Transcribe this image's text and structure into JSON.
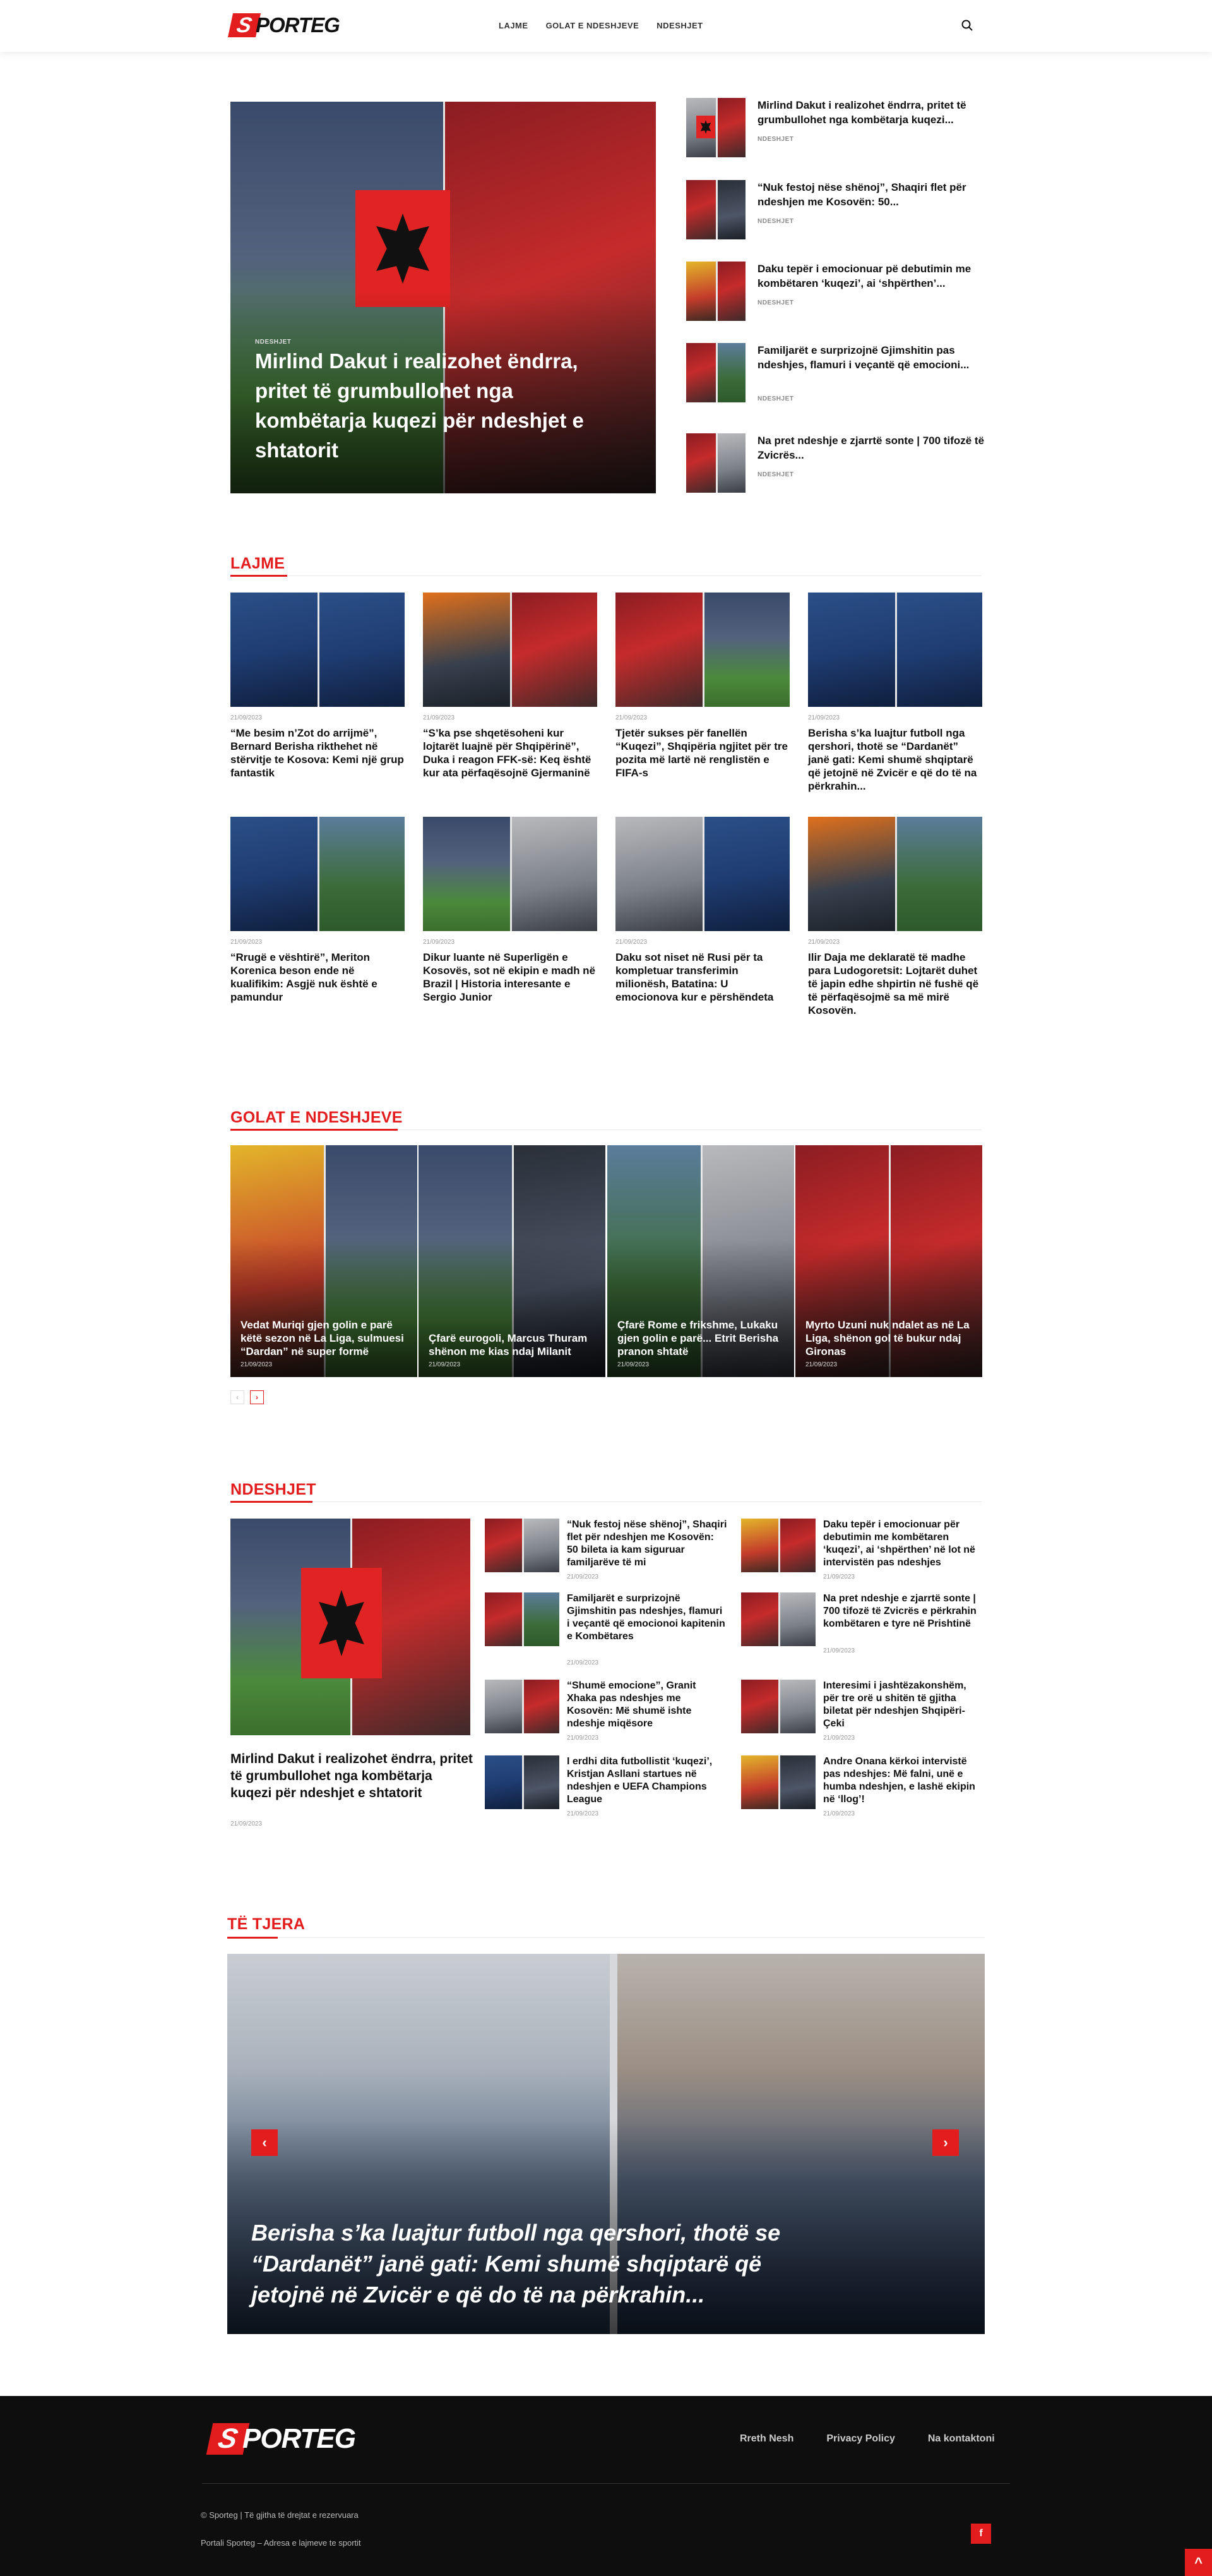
{
  "header": {
    "logo_s": "S",
    "logo_rest": "PORTEG",
    "nav": [
      "LAJME",
      "GOLAT E NDESHJEVE",
      "NDESHJET"
    ],
    "search_icon": "search-icon"
  },
  "hero": {
    "category": "NDESHJET",
    "title": "Mirlind Dakut i realizohet ëndrra, pritet të grumbullohet nga kombëtarja kuqezi për ndeshjet e shtatorit"
  },
  "side_list": [
    {
      "title": "Mirlind Dakut i realizohet ëndrra, pritet të grumbullohet nga kombëtarja kuqezi...",
      "category": "NDESHJET"
    },
    {
      "title": "“Nuk festoj nëse shënoj”, Shaqiri flet për ndeshjen me Kosovën: 50...",
      "category": "NDESHJET"
    },
    {
      "title": "Daku tepër i emocionuar pë debutimin me kombëtaren ‘kuqezi’, ai ‘shpërthen’...",
      "category": "NDESHJET"
    },
    {
      "title": "Familjarët e surprizojnë Gjimshitin pas ndeshjes, flamuri i veçantë që emocioni...",
      "category": "NDESHJET"
    },
    {
      "title": "Na pret ndeshje e zjarrtë sonte | 700 tifozë të Zvicrës...",
      "category": "NDESHJET"
    }
  ],
  "lajme": {
    "title": "LAJME",
    "cards": [
      {
        "date": "21/09/2023",
        "title": "“Me besim n’Zot do arrijmë”, Bernard Berisha rikthehet në stërvitje te Kosova: Kemi një grup fantastik"
      },
      {
        "date": "21/09/2023",
        "title": "“S’ka pse shqetësoheni kur lojtarët luajnë për Shqipërinë”, Duka i reagon FFK-së: Keq është kur ata përfaqësojnë Gjermaninë"
      },
      {
        "date": "21/09/2023",
        "title": "Tjetër sukses për fanellën “Kuqezi”, Shqipëria ngjitet për tre pozita më lartë në renglistën e FIFA-s"
      },
      {
        "date": "21/09/2023",
        "title": "Berisha s’ka luajtur futboll nga qershori, thotë se “Dardanët” janë gati: Kemi shumë shqiptarë që jetojnë në Zvicër e që do të na përkrahin..."
      },
      {
        "date": "21/09/2023",
        "title": "“Rrugë e vështirë”, Meriton Korenica beson ende në kualifikim: Asgjë nuk është e pamundur"
      },
      {
        "date": "21/09/2023",
        "title": "Dikur luante në Superligën e Kosovës, sot në ekipin e madh në Brazil | Historia interesante e Sergio Junior"
      },
      {
        "date": "21/09/2023",
        "title": "Daku sot niset në Rusi për ta kompletuar transferimin milionësh, Batatina: U emocionova kur e përshëndeta"
      },
      {
        "date": "21/09/2023",
        "title": "Ilir Daja me deklaratë të madhe para Ludogoretsit: Lojtarët duhet të japin edhe shpirtin në fushë që të përfaqësojmë sa më mirë Kosovën."
      }
    ]
  },
  "golat": {
    "title": "GOLAT E NDESHJEVE",
    "cards": [
      {
        "title": "Vedat Muriqi gjen golin e parë këtë sezon në La Liga, sulmuesi “Dardan” në super formë",
        "date": "21/09/2023"
      },
      {
        "title": "Çfarë eurogoli, Marcus Thuram shënon me kias ndaj Milanit",
        "date": "21/09/2023"
      },
      {
        "title": "Çfarë Rome e frikshme, Lukaku gjen golin e parë... Etrit Berisha pranon shtatë",
        "date": "21/09/2023"
      },
      {
        "title": "Myrto Uzuni nuk ndalet as në La Liga, shënon gol të bukur ndaj Gironas",
        "date": "21/09/2023"
      }
    ],
    "prev": "‹",
    "next": "›"
  },
  "ndeshjet": {
    "title": "NDESHJET",
    "main": {
      "title": "Mirlind Dakut i realizohet ëndrra, pritet të grumbullohet nga kombëtarja kuqezi për ndeshjet e shtatorit",
      "date": "21/09/2023"
    },
    "items": [
      {
        "title": "“Nuk festoj nëse shënoj”, Shaqiri flet për ndeshjen me Kosovën: 50 bileta ia kam siguruar familjarëve të mi",
        "date": "21/09/2023"
      },
      {
        "title": "Daku tepër i emocionuar për debutimin me kombëtaren ‘kuqezi’, ai ‘shpërthen’ në lot në intervistën pas ndeshjes",
        "date": "21/09/2023"
      },
      {
        "title": "Familjarët e surprizojnë Gjimshitin pas ndeshjes, flamuri i veçantë që emocionoi kapitenin e Kombëtares",
        "date": "21/09/2023"
      },
      {
        "title": "Na pret ndeshje e zjarrtë sonte | 700 tifozë të Zvicrës e përkrahin kombëtaren e tyre në Prishtinë",
        "date": "21/09/2023"
      },
      {
        "title": "“Shumë emocione”, Granit Xhaka pas ndeshjes me Kosovën: Më shumë ishte ndeshje miqësore",
        "date": "21/09/2023"
      },
      {
        "title": "Interesimi i jashtëzakonshëm, për tre orë u shitën të gjitha biletat për ndeshjen Shqipëri-Çeki",
        "date": "21/09/2023"
      },
      {
        "title": "I erdhi dita futbollistit ‘kuqezi’, Kristjan Asllani startues në ndeshjen e UEFA Champions League",
        "date": "21/09/2023"
      },
      {
        "title": "Andre Onana kërkoi intervistë pas ndeshjes: Më falni, unë e humba ndeshjen, e lashë ekipin në ‘llog’!",
        "date": "21/09/2023"
      }
    ]
  },
  "tetjera": {
    "title": "TË TJERA",
    "slide_title": "Berisha s’ka luajtur futboll nga qershori, thotë se “Dardanët” janë gati: Kemi shumë shqiptarë që jetojnë në Zvicër e që do të na përkrahin...",
    "prev": "‹",
    "next": "›"
  },
  "footer": {
    "logo_s": "S",
    "logo_rest": "PORTEG",
    "links": [
      "Rreth Nesh",
      "Privacy Policy",
      "Na kontaktoni"
    ],
    "copyright": "© Sporteg | Të gjitha të drejtat e rezervuara",
    "about": "Portali Sporteg – Adresa e lajmeve te sportit",
    "facebook": "f",
    "to_top": "^"
  },
  "colors": {
    "accent": "#e31d1d",
    "footer_bg": "#0e0e0e"
  }
}
